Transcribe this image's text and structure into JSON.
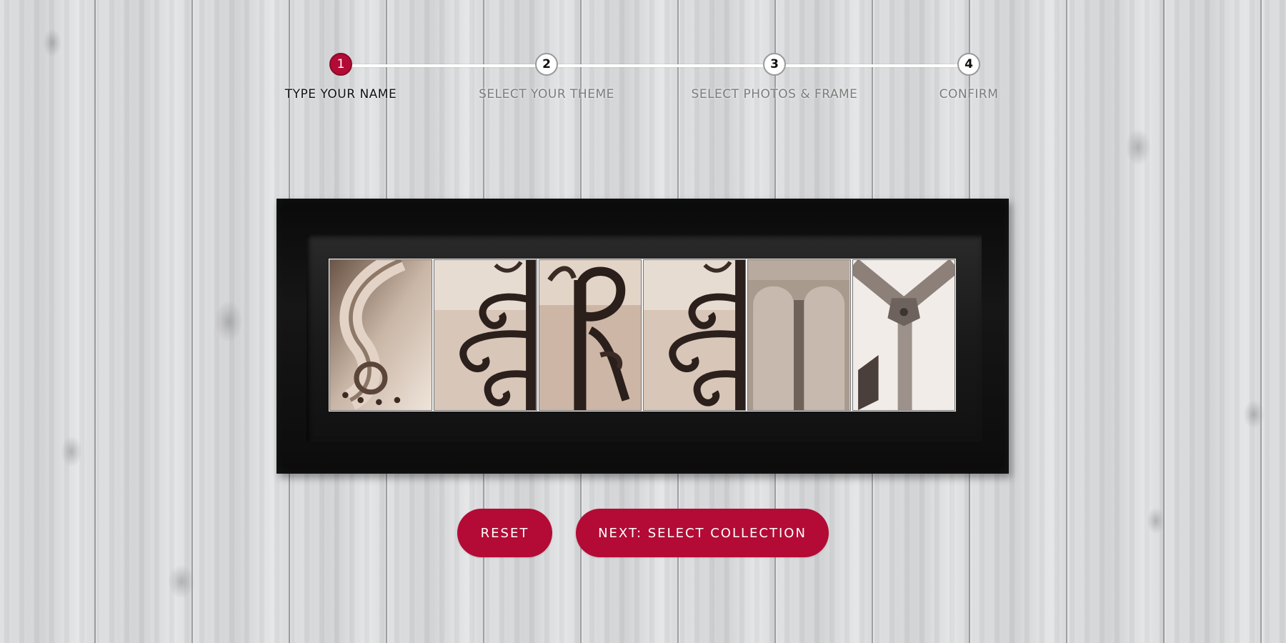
{
  "stepper": {
    "active_step": 1,
    "steps": [
      {
        "number": "1",
        "label": "TYPE YOUR NAME"
      },
      {
        "number": "2",
        "label": "SELECT YOUR THEME"
      },
      {
        "number": "3",
        "label": "SELECT PHOTOS & FRAME"
      },
      {
        "number": "4",
        "label": "CONFIRM"
      }
    ]
  },
  "preview": {
    "tiles": [
      {
        "icon": "scroll-s-photo"
      },
      {
        "icon": "iron-scroll-e-photo"
      },
      {
        "icon": "iron-r-photo"
      },
      {
        "icon": "iron-scroll-e-photo"
      },
      {
        "icon": "column-n-photo"
      },
      {
        "icon": "metal-y-photo"
      }
    ]
  },
  "buttons": {
    "reset": "RESET",
    "next": "NEXT: SELECT COLLECTION"
  },
  "colors": {
    "accent": "#b30b36",
    "frame": "#0c0c0c",
    "background": "#d9dadb"
  }
}
